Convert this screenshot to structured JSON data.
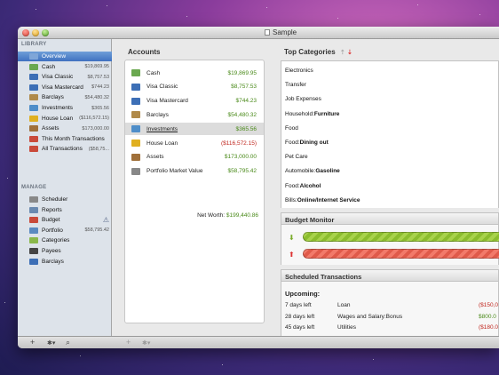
{
  "window": {
    "title": "Sample"
  },
  "sidebar": {
    "library_header": "LIBRARY",
    "manage_header": "MANAGE",
    "library_items": [
      {
        "label": "Overview",
        "value": "",
        "icon": "overview-icon",
        "color": "#7fa6d8",
        "selected": true
      },
      {
        "label": "Cash",
        "value": "$19,869.95",
        "icon": "cash-icon",
        "color": "#6aa84f"
      },
      {
        "label": "Visa Classic",
        "value": "$8,757.53",
        "icon": "card-icon",
        "color": "#3d6fb6"
      },
      {
        "label": "Visa Mastercard",
        "value": "$744.23",
        "icon": "card-icon",
        "color": "#3d6fb6"
      },
      {
        "label": "Barclays",
        "value": "$54,480.32",
        "icon": "bank-icon",
        "color": "#b08a4a"
      },
      {
        "label": "Investments",
        "value": "$365.56",
        "icon": "chart-icon",
        "color": "#4f8ec9"
      },
      {
        "label": "House Loan",
        "value": "($116,572.15)",
        "icon": "loan-icon",
        "color": "#e0b020"
      },
      {
        "label": "Assets",
        "value": "$173,000.00",
        "icon": "asset-icon",
        "color": "#a0703a"
      },
      {
        "label": "This Month Transactions",
        "value": "",
        "icon": "calendar-icon",
        "color": "#c94a3a"
      },
      {
        "label": "All Transactions",
        "value": "($58,75...",
        "icon": "calendar-icon",
        "color": "#c94a3a"
      }
    ],
    "manage_items": [
      {
        "label": "Scheduler",
        "value": "",
        "icon": "clock-icon",
        "color": "#888888"
      },
      {
        "label": "Reports",
        "value": "",
        "icon": "reports-icon",
        "color": "#6a8ab0"
      },
      {
        "label": "Budget",
        "value": "",
        "icon": "budget-icon",
        "color": "#c94a3a",
        "warn": "⚠"
      },
      {
        "label": "Portfolio",
        "value": "$58,795.42",
        "icon": "portfolio-icon",
        "color": "#5a8ac0"
      },
      {
        "label": "Categories",
        "value": "",
        "icon": "categories-icon",
        "color": "#8ab84a"
      },
      {
        "label": "Payees",
        "value": "",
        "icon": "payees-icon",
        "color": "#444444"
      },
      {
        "label": "Barclays",
        "value": "",
        "icon": "bank-icon",
        "color": "#3d6fb6"
      }
    ]
  },
  "accounts": {
    "title": "Accounts",
    "rows": [
      {
        "label": "Cash",
        "value": "$19,869.95",
        "sign": "pos",
        "icon": "cash-icon",
        "color": "#6aa84f"
      },
      {
        "label": "Visa Classic",
        "value": "$8,757.53",
        "sign": "pos",
        "icon": "card-icon",
        "color": "#3d6fb6"
      },
      {
        "label": "Visa Mastercard",
        "value": "$744.23",
        "sign": "pos",
        "icon": "card-icon",
        "color": "#3d6fb6"
      },
      {
        "label": "Barclays",
        "value": "$54,480.32",
        "sign": "pos",
        "icon": "bank-icon",
        "color": "#b08a4a"
      },
      {
        "label": "Investments",
        "value": "$365.56",
        "sign": "pos",
        "icon": "chart-icon",
        "color": "#4f8ec9",
        "selected": true
      },
      {
        "label": "House Loan",
        "value": "($116,572.15)",
        "sign": "neg",
        "icon": "loan-icon",
        "color": "#e0b020"
      },
      {
        "label": "Assets",
        "value": "$173,000.00",
        "sign": "pos",
        "icon": "asset-icon",
        "color": "#a0703a"
      },
      {
        "label": "Portfolio Market Value",
        "value": "$58,795.42",
        "sign": "pos",
        "icon": "portfolio-icon",
        "color": "#888888"
      }
    ],
    "net_worth_label": "Net Worth:",
    "net_worth_value": "$199,440.86"
  },
  "top_categories": {
    "title": "Top Categories",
    "items": [
      {
        "prefix": "Electronics",
        "bold": ""
      },
      {
        "prefix": "Transfer",
        "bold": ""
      },
      {
        "prefix": "Job Expenses",
        "bold": ""
      },
      {
        "prefix": "Household:",
        "bold": "Furniture"
      },
      {
        "prefix": "Food",
        "bold": ""
      },
      {
        "prefix": "Food:",
        "bold": "Dining out"
      },
      {
        "prefix": "Pet Care",
        "bold": ""
      },
      {
        "prefix": "Automobile:",
        "bold": "Gasoline"
      },
      {
        "prefix": "Food:",
        "bold": "Alcohol"
      },
      {
        "prefix": "Bills:",
        "bold": "Online/Internet Service"
      }
    ]
  },
  "budget_monitor": {
    "title": "Budget Monitor"
  },
  "scheduled": {
    "title": "Scheduled Transactions",
    "upcoming_label": "Upcoming:",
    "rows": [
      {
        "when": "7 days left",
        "payee": "Loan",
        "amount": "($150,0",
        "sign": "neg"
      },
      {
        "when": "28 days left",
        "payee": "Wages and Salary:Bonus",
        "amount": "$800.0",
        "sign": "pos"
      },
      {
        "when": "45 days left",
        "payee": "Utilities",
        "amount": "($180.0",
        "sign": "neg"
      },
      {
        "when": "45 days left",
        "payee": "Wages and Salary",
        "amount": "$8,000.0",
        "sign": "pos"
      }
    ]
  },
  "bottombar": {
    "add": "+",
    "gear": "✱▾",
    "search": "⌕"
  }
}
